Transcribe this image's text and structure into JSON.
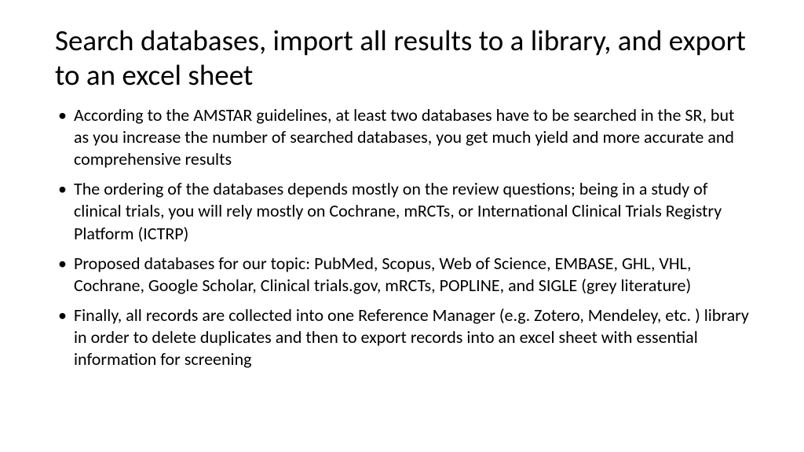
{
  "slide": {
    "title": "Search databases, import all results to a library, and export to an excel sheet",
    "bullets": [
      "According to the AMSTAR guidelines, at least two databases have to be searched in the SR, but as you increase the number of searched databases, you get much yield and more accurate and comprehensive results",
      "The ordering of the databases depends mostly on the review questions; being in a study of clinical trials, you will rely mostly on Cochrane, mRCTs, or International Clinical Trials Registry Platform (ICTRP)",
      "Proposed databases for our topic: PubMed, Scopus, Web of Science, EMBASE, GHL, VHL, Cochrane, Google Scholar, Clinical trials.gov, mRCTs, POPLINE, and SIGLE (grey literature)",
      "Finally, all records are collected into one Reference Manager (e.g. Zotero, Mendeley, etc. ) library in order to delete duplicates and then to export records into an excel sheet with essential information for screening"
    ]
  }
}
